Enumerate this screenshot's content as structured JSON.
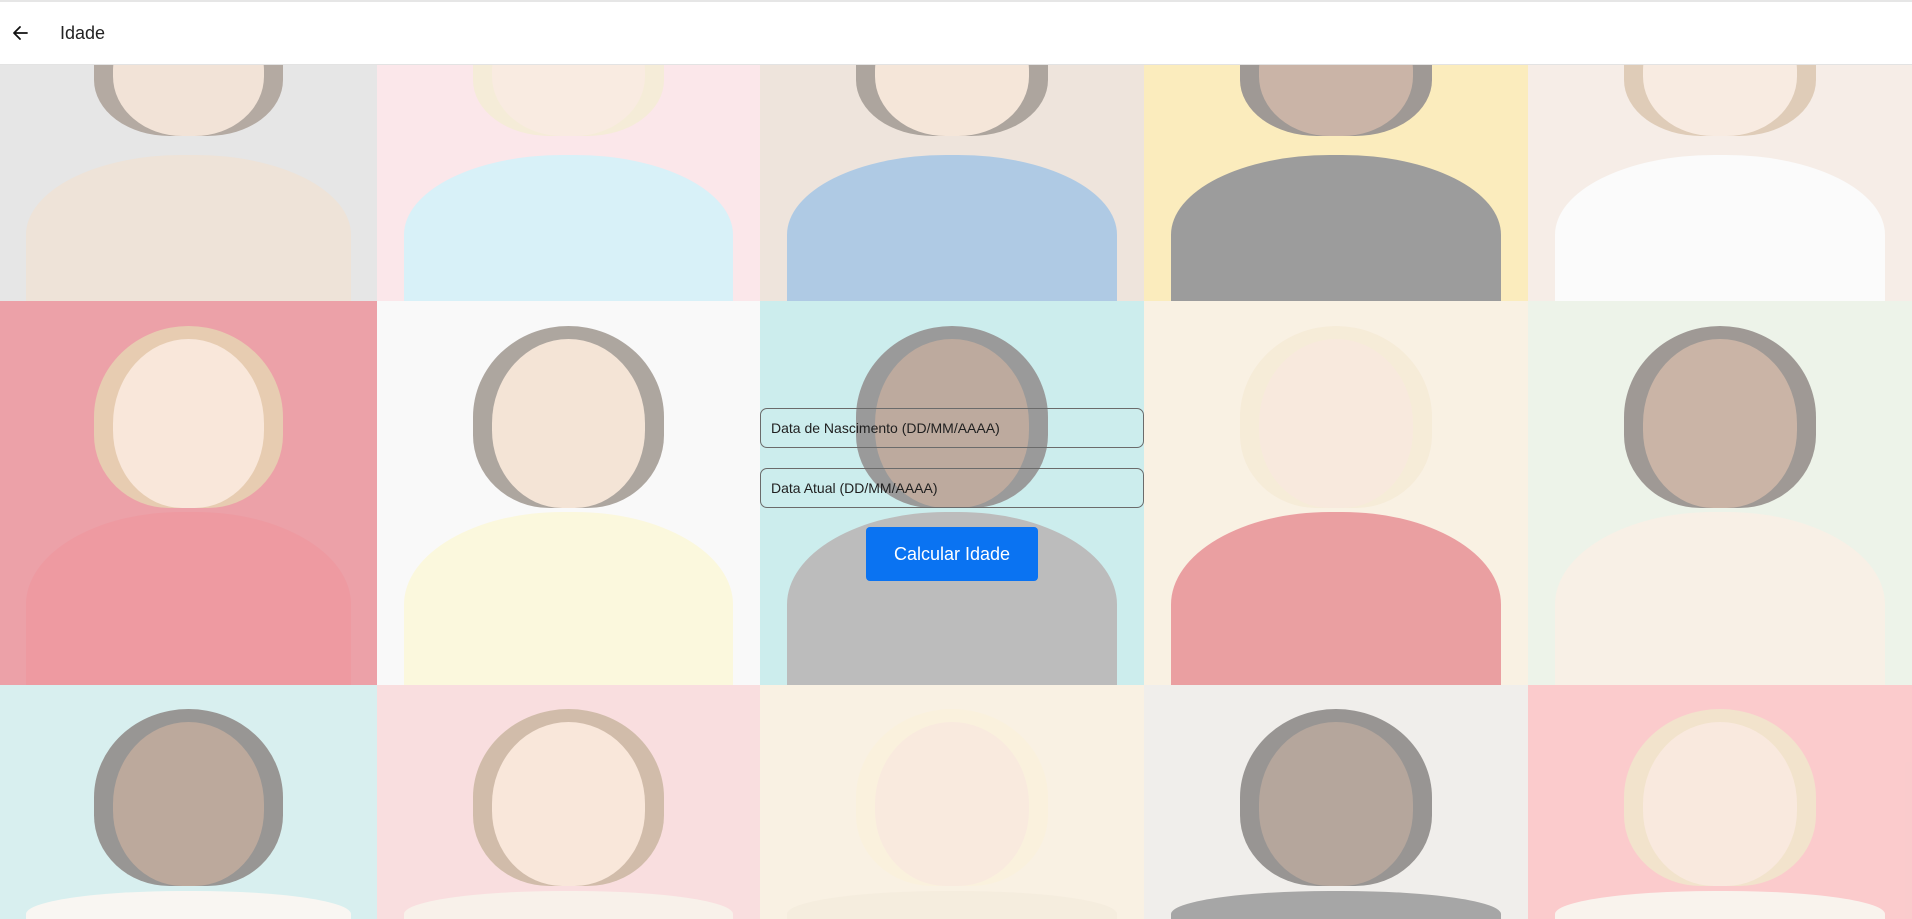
{
  "header": {
    "title": "Idade",
    "back_icon": "arrow-left-icon"
  },
  "background": {
    "description_tiles": [
      {
        "bg": "#c7c7c7",
        "skin": "#e2c2a6",
        "hair": "#5a4332",
        "cloth": "#d9c0a8"
      },
      {
        "bg": "#f6c9d0",
        "skin": "#f2d2bd",
        "hair": "#e9d4a8",
        "cloth": "#a8dff0"
      },
      {
        "bg": "#d9c4b1",
        "skin": "#e8c7ac",
        "hair": "#4b3828",
        "cloth": "#4f8bc4"
      },
      {
        "bg": "#f7d66d",
        "skin": "#8b5a3c",
        "hair": "#2b1d14",
        "cloth": "#242424"
      },
      {
        "bg": "#ead7c9",
        "skin": "#f0d3bd",
        "hair": "#b88f63",
        "cloth": "#f5f5f5"
      },
      {
        "bg": "#d62f3f",
        "skin": "#f1c9ae",
        "hair": "#c98f52",
        "cloth": "#d91f2f"
      },
      {
        "bg": "#f2f2f2",
        "skin": "#e7c3a5",
        "hair": "#4a3a2c",
        "cloth": "#f7efb4"
      },
      {
        "bg": "#8fd7d8",
        "skin": "#6d4428",
        "hair": "#1f1f1f",
        "cloth": "#6c6c6c"
      },
      {
        "bg": "#f2dfc2",
        "skin": "#f0cfb4",
        "hair": "#ecd4a8",
        "cloth": "#d12a2f"
      },
      {
        "bg": "#d7e5cf",
        "skin": "#8a5a3a",
        "hair": "#2a1e16",
        "cloth": "#f0ddc7"
      },
      {
        "bg": "#a9dcdc",
        "skin": "#6a4025",
        "hair": "#1c1712",
        "cloth": "#f1ece2"
      },
      {
        "bg": "#f2b7b8",
        "skin": "#f1c9ae",
        "hair": "#9a6b43",
        "cloth": "#f0e0d0"
      },
      {
        "bg": "#f1dfc2",
        "skin": "#f2d0b6",
        "hair": "#f3e1b3",
        "cloth": "#e9d7b5"
      },
      {
        "bg": "#dedad2",
        "skin": "#5b3a25",
        "hair": "#1b1511",
        "cloth": "#3a3a3a"
      },
      {
        "bg": "#f58c8f",
        "skin": "#f2cfb5",
        "hair": "#e3c08e",
        "cloth": "#f2e5d8"
      }
    ]
  },
  "form": {
    "birth_placeholder": "Data de Nascimento (DD/MM/AAAA)",
    "current_placeholder": "Data Atual (DD/MM/AAAA)",
    "submit_label": "Calcular Idade"
  },
  "colors": {
    "accent": "#0a73f2"
  }
}
